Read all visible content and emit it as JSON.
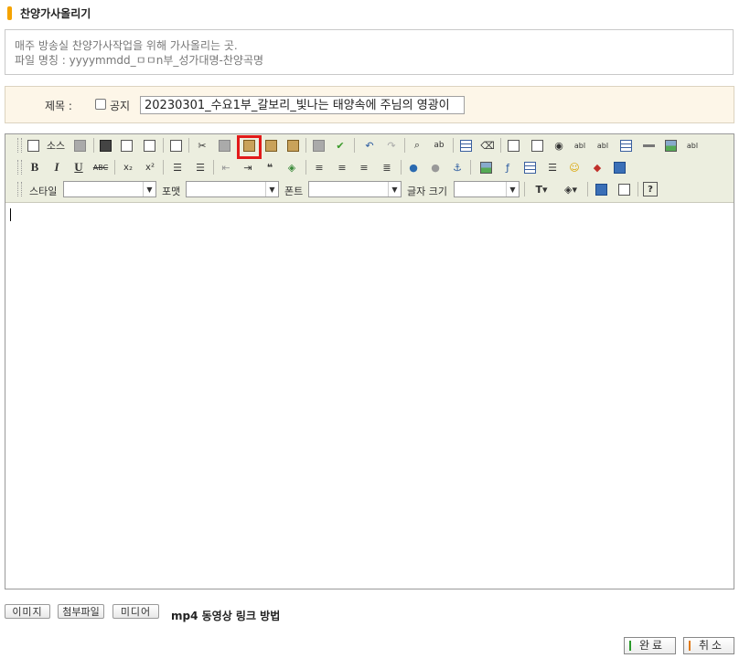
{
  "header": {
    "title": "찬양가사올리기"
  },
  "notice": {
    "line1": "매주 방송실 찬양가사작업을 위해 가사올리는 곳.",
    "line2": "파일 명칭 : yyyymmdd_ㅁㅁn부_성가대명-찬양곡명"
  },
  "form": {
    "title_label": "제목 :",
    "notice_label": "공지",
    "title_value": "20230301_수요1부_갈보리_빛나는 태양속에 주님의 영광이"
  },
  "toolbar": {
    "source_label": "소스",
    "style_label": "스타일",
    "format_label": "포맷",
    "font_label": "폰트",
    "size_label": "글자 크기",
    "style_value": "",
    "format_value": "",
    "font_value": "",
    "size_value": "",
    "highlighted_button": "paste-from-clipboard-icon"
  },
  "attachments": {
    "image_label": "이미지",
    "file_label": "첨부파일",
    "media_label": "미디어",
    "mp4_link": "mp4 동영상 링크 방법"
  },
  "actions": {
    "ok_label": "완료",
    "cancel_label": "취소",
    "ok_color": "#2a9a2a",
    "cancel_color": "#e07a1a"
  },
  "colors": {
    "accent": "#f5a300",
    "highlight": "#e21a1a"
  }
}
